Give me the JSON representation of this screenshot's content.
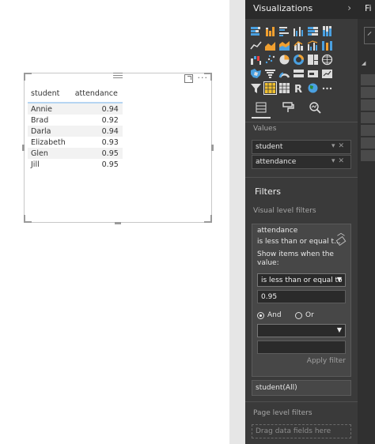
{
  "visual": {
    "table": {
      "columns": [
        "student",
        "attendance"
      ],
      "rows": [
        {
          "student": "Annie",
          "attendance": "0.94"
        },
        {
          "student": "Brad",
          "attendance": "0.92"
        },
        {
          "student": "Darla",
          "attendance": "0.94"
        },
        {
          "student": "Elizabeth",
          "attendance": "0.93"
        },
        {
          "student": "Glen",
          "attendance": "0.95"
        },
        {
          "student": "Jill",
          "attendance": "0.95"
        }
      ]
    },
    "icons": [
      "focus-mode-icon",
      "more-options-icon"
    ],
    "more_label": "···"
  },
  "pane": {
    "title": "Visualizations",
    "chevron": "›",
    "gallery_icons": [
      [
        "stacked-bar",
        "stacked-column",
        "clustered-bar",
        "clustered-column",
        "100-stacked-bar",
        "100-stacked-column"
      ],
      [
        "line",
        "area",
        "stacked-area",
        "line-column",
        "line-clustered-column",
        "ribbon"
      ],
      [
        "waterfall",
        "scatter",
        "pie",
        "donut",
        "treemap",
        "map"
      ],
      [
        "filled-map",
        "funnel",
        "gauge",
        "multi-row-card",
        "card",
        "kpi"
      ],
      [
        "slicer",
        "table",
        "matrix",
        "r-script",
        "globe",
        "more"
      ]
    ],
    "subtabs": [
      "fields",
      "format",
      "analytics"
    ],
    "values_label": "Values",
    "values_wells": [
      {
        "label": "student"
      },
      {
        "label": "attendance"
      }
    ],
    "filters_title": "Filters",
    "visual_level_filters_label": "Visual level filters",
    "filter_card": {
      "field": "attendance",
      "summary": "is less than or equal t...",
      "show_items_line1": "Show items when the",
      "show_items_line2": "value:",
      "operator": "is less than or equal to",
      "value": "0.95",
      "and_label": "And",
      "or_label": "Or",
      "apply_label": "Apply filter"
    },
    "student_filter": "student(All)",
    "page_level_filters_label": "Page level filters",
    "drop_placeholder": "Drag data fields here"
  },
  "strip": {
    "title": "Fi"
  },
  "colors": {
    "pane_bg": "#3a3a3a",
    "header_bg": "#2a2a2a",
    "table_header_underline": "#b6d5f2",
    "row_band": "#f2f2f2"
  }
}
